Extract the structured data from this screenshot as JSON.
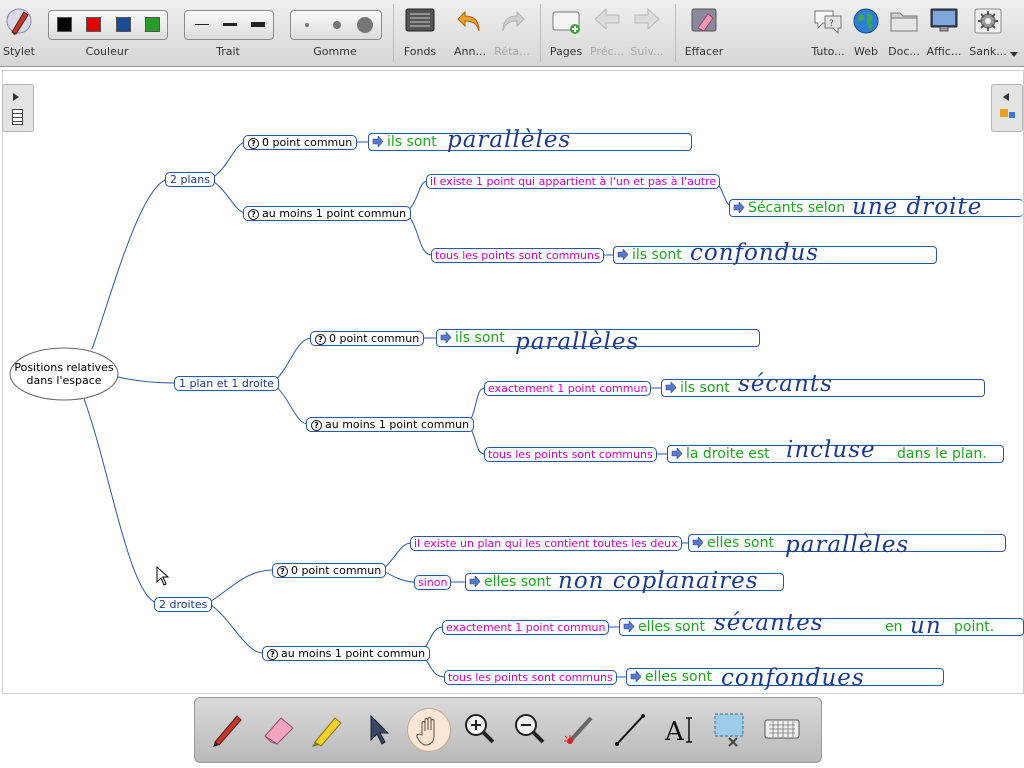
{
  "toolbar": {
    "items": [
      {
        "label": "Stylet",
        "icon": "stylus-icon"
      },
      {
        "label": "Couleur",
        "icon": "color-picker"
      },
      {
        "label": "Trait",
        "icon": "stroke-picker"
      },
      {
        "label": "Gomme",
        "icon": "eraser-size-picker"
      },
      {
        "label": "Fonds",
        "icon": "background-icon"
      },
      {
        "label": "Ann...",
        "icon": "undo-icon"
      },
      {
        "label": "Réta...",
        "icon": "redo-icon",
        "disabled": true
      },
      {
        "label": "Pages",
        "icon": "pages-icon"
      },
      {
        "label": "Préc...",
        "icon": "previous-icon",
        "disabled": true
      },
      {
        "label": "Suiv...",
        "icon": "next-icon",
        "disabled": true
      },
      {
        "label": "Effacer",
        "icon": "clear-icon"
      },
      {
        "label": "Tuto...",
        "icon": "tutorial-icon"
      },
      {
        "label": "Web",
        "icon": "web-globe-icon"
      },
      {
        "label": "Doc...",
        "icon": "documents-folder-icon"
      },
      {
        "label": "Affic...",
        "icon": "display-icon"
      },
      {
        "label": "Sank...",
        "icon": "settings-gear-icon"
      }
    ],
    "colors": [
      "#000000",
      "#e00000",
      "#1c4c96",
      "#2a9a2a"
    ]
  },
  "mindmap": {
    "root": "Positions relatives\ndans l'espace",
    "root_line1": "Positions relatives",
    "root_line2": "dans l'espace",
    "branches": {
      "plans": "2 plans",
      "plan_droite": "1 plan et 1 droite",
      "droites": "2 droites"
    },
    "q": {
      "p0": "0 point commun",
      "p1": "au moins 1 point commun",
      "pd0": "0 point commun",
      "pd1": "au moins 1 point commun",
      "d0": "0 point commun",
      "d1": "au moins 1 point commun"
    },
    "mag": {
      "p_exists": "il existe 1 point qui appartient à l'un et pas à l'autre",
      "p_all": "tous les points sont communs",
      "pd_one": "exactement 1 point commun",
      "pd_all": "tous les points sont communs",
      "d_plane": "il existe un plan qui les contient toutes les deux",
      "d_sinon": "sinon",
      "d_one": "exactement 1 point commun",
      "d_all": "tous les points sont communs"
    },
    "answers": {
      "a1_text": "ils sont",
      "a1_hand": "parallèles",
      "a2_text": "Sécants selon",
      "a2_hand": "une droite",
      "a3_text": "ils sont",
      "a3_hand": "confondus",
      "a4_text": "ils sont",
      "a4_hand": "parallèles",
      "a5_text": "ils sont",
      "a5_hand": "sécants",
      "a6_text": "la droite est",
      "a6_hand": "incluse",
      "a6_tail": "dans le plan.",
      "a7_text": "elles sont",
      "a7_hand": "parallèles",
      "a8_text": "elles sont",
      "a8_hand": "non coplanaires",
      "a9_text": "elles sont",
      "a9_hand": "sécantes",
      "a9_mid": "en",
      "a9_hand2": "un",
      "a9_tail": "point.",
      "a10_text": "elles sont",
      "a10_hand": "confondues"
    }
  },
  "palette": {
    "tools": [
      "pen-icon",
      "eraser-icon",
      "highlighter-icon",
      "pointer-arrow-icon",
      "hand-pan-icon",
      "zoom-in-icon",
      "zoom-out-icon",
      "laser-pointer-icon",
      "line-icon",
      "text-tool-icon",
      "capture-icon",
      "keyboard-icon"
    ],
    "active": "hand-pan-icon"
  }
}
